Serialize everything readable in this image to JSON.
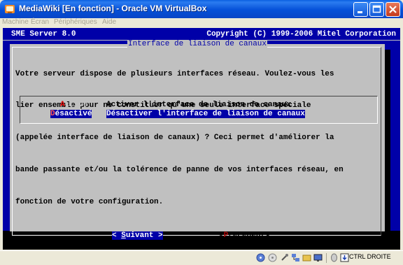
{
  "window": {
    "title": "MediaWiki [En fonction] - Oracle VM VirtualBox",
    "controls": [
      "minimize",
      "maximize",
      "close"
    ]
  },
  "menubar": {
    "items": [
      "Machine",
      "Écran",
      "Périphériques",
      "Aide"
    ]
  },
  "vm": {
    "header_left": "SME Server 8.0",
    "header_right": "Copyright (C) 1999-2006 Mitel Corporation",
    "dialog": {
      "title": "Interface de liaison de canaux",
      "description": [
        "Votre serveur dispose de plusieurs interfaces réseau. Voulez-vous les",
        "lier ensemble pour ne constituer qu'une seule interface spéciale",
        "(appelée interface de liaison de canaux) ? Ceci permet d'améliorer la",
        "bande passante et/ou la tolérence de panne de vos interfaces réseau, en",
        "fonction de votre configuration."
      ],
      "options": [
        {
          "tag_first": "A",
          "tag_rest": "ctivé",
          "label": "Activer l'interface de liaison de canaux",
          "selected": false
        },
        {
          "tag_first": "D",
          "tag_rest": "ésactivé",
          "label": "Désactiver l'interface de liaison de canaux",
          "selected": true
        }
      ],
      "buttons": {
        "next_pre": "< ",
        "next_key": "S",
        "next_rest": "uivant",
        "next_post": " >",
        "prev_pre": "<",
        "prev_key": "P",
        "prev_rest": "récédent",
        "prev_post": ">"
      }
    }
  },
  "statusbar": {
    "icons": [
      "hard-disk-icon",
      "cd-icon",
      "usb-icon",
      "network-icon",
      "shared-folder-icon",
      "display-icon",
      "mouse-icon",
      "keyboard-icon"
    ],
    "host_key": "CTRL DROITE"
  },
  "colors": {
    "console_blue": "#0000a8",
    "dialog_gray": "#c0c0c0",
    "hotkey_red": "#e00000",
    "titlebar_blue": "#0550d8"
  }
}
